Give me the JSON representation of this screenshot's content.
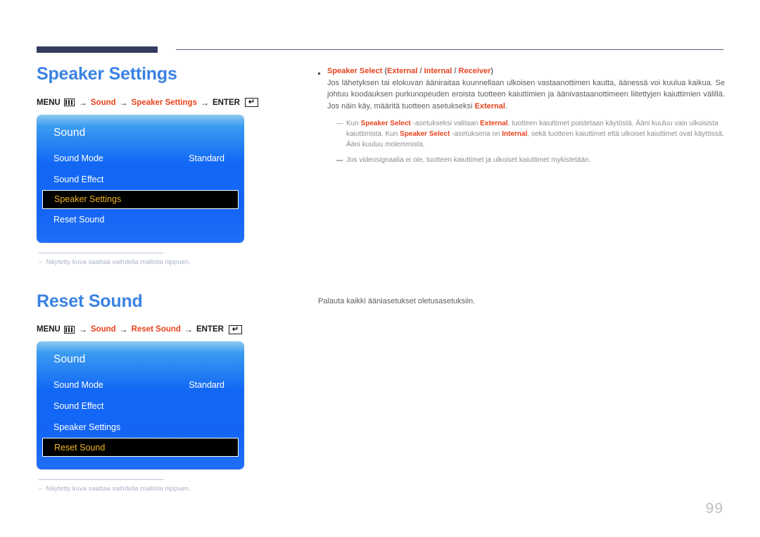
{
  "page": {
    "number": "99",
    "language": "fi"
  },
  "sections": [
    {
      "id": "speaker-settings",
      "title": "Speaker Settings",
      "menu_path": {
        "menu_label": "MENU",
        "menu_icon": "menu-bars-icon",
        "arrow": "→",
        "steps": [
          "Sound",
          "Speaker Settings"
        ],
        "enter_label": "ENTER",
        "enter_icon": "enter-return-icon",
        "enter_glyph": "↵"
      },
      "osd": {
        "title": "Sound",
        "rows": [
          {
            "label": "Sound Mode",
            "value": "Standard",
            "selected": false
          },
          {
            "label": "Sound Effect",
            "value": "",
            "selected": false
          },
          {
            "label": "Speaker Settings",
            "value": "",
            "selected": true
          },
          {
            "label": "Reset Sound",
            "value": "",
            "selected": false
          }
        ]
      },
      "footnote": {
        "dash": "–",
        "text": "Näytetty kuva saattaa vaihdella mallista riippuen."
      }
    },
    {
      "id": "reset-sound",
      "title": "Reset Sound",
      "menu_path": {
        "menu_label": "MENU",
        "menu_icon": "menu-bars-icon",
        "arrow": "→",
        "steps": [
          "Sound",
          "Reset Sound"
        ],
        "enter_label": "ENTER",
        "enter_icon": "enter-return-icon",
        "enter_glyph": "↵"
      },
      "osd": {
        "title": "Sound",
        "rows": [
          {
            "label": "Sound Mode",
            "value": "Standard",
            "selected": false
          },
          {
            "label": "Sound Effect",
            "value": "",
            "selected": false
          },
          {
            "label": "Speaker Settings",
            "value": "",
            "selected": false
          },
          {
            "label": "Reset Sound",
            "value": "",
            "selected": true
          }
        ]
      },
      "footnote": {
        "dash": "–",
        "text": "Näytetty kuva saattaa vaihdella mallista riippuen."
      }
    }
  ],
  "right": {
    "speaker_select": {
      "bullet_head_bold": "Speaker Select",
      "bullet_head_options_open": " (",
      "bullet_head_opt1": "External",
      "bullet_head_sep1": " / ",
      "bullet_head_opt2": "Internal",
      "bullet_head_sep2": " / ",
      "bullet_head_opt3": "Receiver",
      "bullet_head_options_close": ")",
      "paragraph_part1": "Jos lähetyksen tai elokuvan ääniraitaa kuunnellaan ulkoisen vastaanottimen kautta, äänessä voi kuulua kaikua. Se johtuu koodauksen purkunopeuden eroista tuotteen kaiuttimien ja äänivastaanottimeen liitettyjen kaiuttimien välillä. Jos näin käy, määritä tuotteen asetukseksi ",
      "paragraph_bold1": "External",
      "paragraph_part2": ".",
      "subnotes": [
        {
          "t1": "Kun ",
          "b1": "Speaker Select",
          "t2": " -asetukseksi valitaan ",
          "b2": "External",
          "t3": ", tuotteen kaiuttimet poistetaan käytöstä. Ääni kuuluu vain ulkoisista kaiuttimista. Kun ",
          "b3": "Speaker Select",
          "t4": " -asetuksena on ",
          "b4": "Internal",
          "t5": ", sekä tuotteen kaiuttimet että ulkoiset kaiuttimet ovat käytössä. Ääni kuuluu molemmista."
        },
        {
          "t1": "Jos videosignaalia ei ole, tuotteen kaiuttimet ja ulkoiset kaiuttimet mykistetään.",
          "b1": "",
          "t2": "",
          "b2": "",
          "t3": "",
          "b3": "",
          "t4": "",
          "b4": "",
          "t5": ""
        }
      ]
    },
    "reset_sound": {
      "description": "Palauta kaikki ääniasetukset oletusasetuksiin."
    }
  },
  "colors": {
    "heading_blue": "#3b82e3",
    "accent_red": "#e8421c",
    "rule_navy": "#343b5e",
    "osd_blue": "#1268f5",
    "osd_selected_text": "#f0b323",
    "body_gray": "#5d5d5d"
  }
}
